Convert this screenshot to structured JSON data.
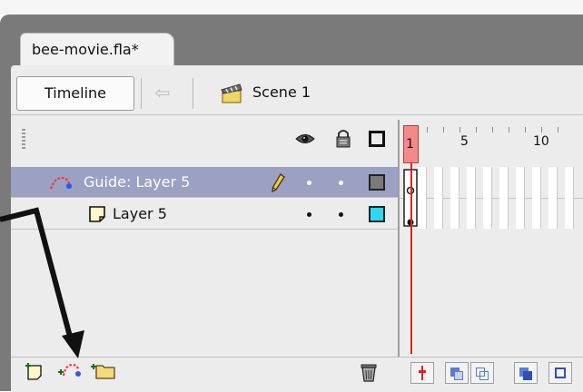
{
  "document": {
    "tab_label": "bee-movie.fla*"
  },
  "edit_bar": {
    "timeline_button": "Timeline",
    "scene_label": "Scene 1"
  },
  "layers": [
    {
      "name": "Guide: Layer 5",
      "type": "guide",
      "selected": true,
      "outline_color": "#7a7a7a"
    },
    {
      "name": "Layer 5",
      "type": "normal",
      "selected": false,
      "outline_color": "#2dd8f2"
    }
  ],
  "ruler": {
    "labels": [
      "1",
      "5",
      "10"
    ]
  },
  "colors": {
    "playhead": "#e02020",
    "selected_row": "#9aa1c3",
    "panel": "#ececec"
  }
}
